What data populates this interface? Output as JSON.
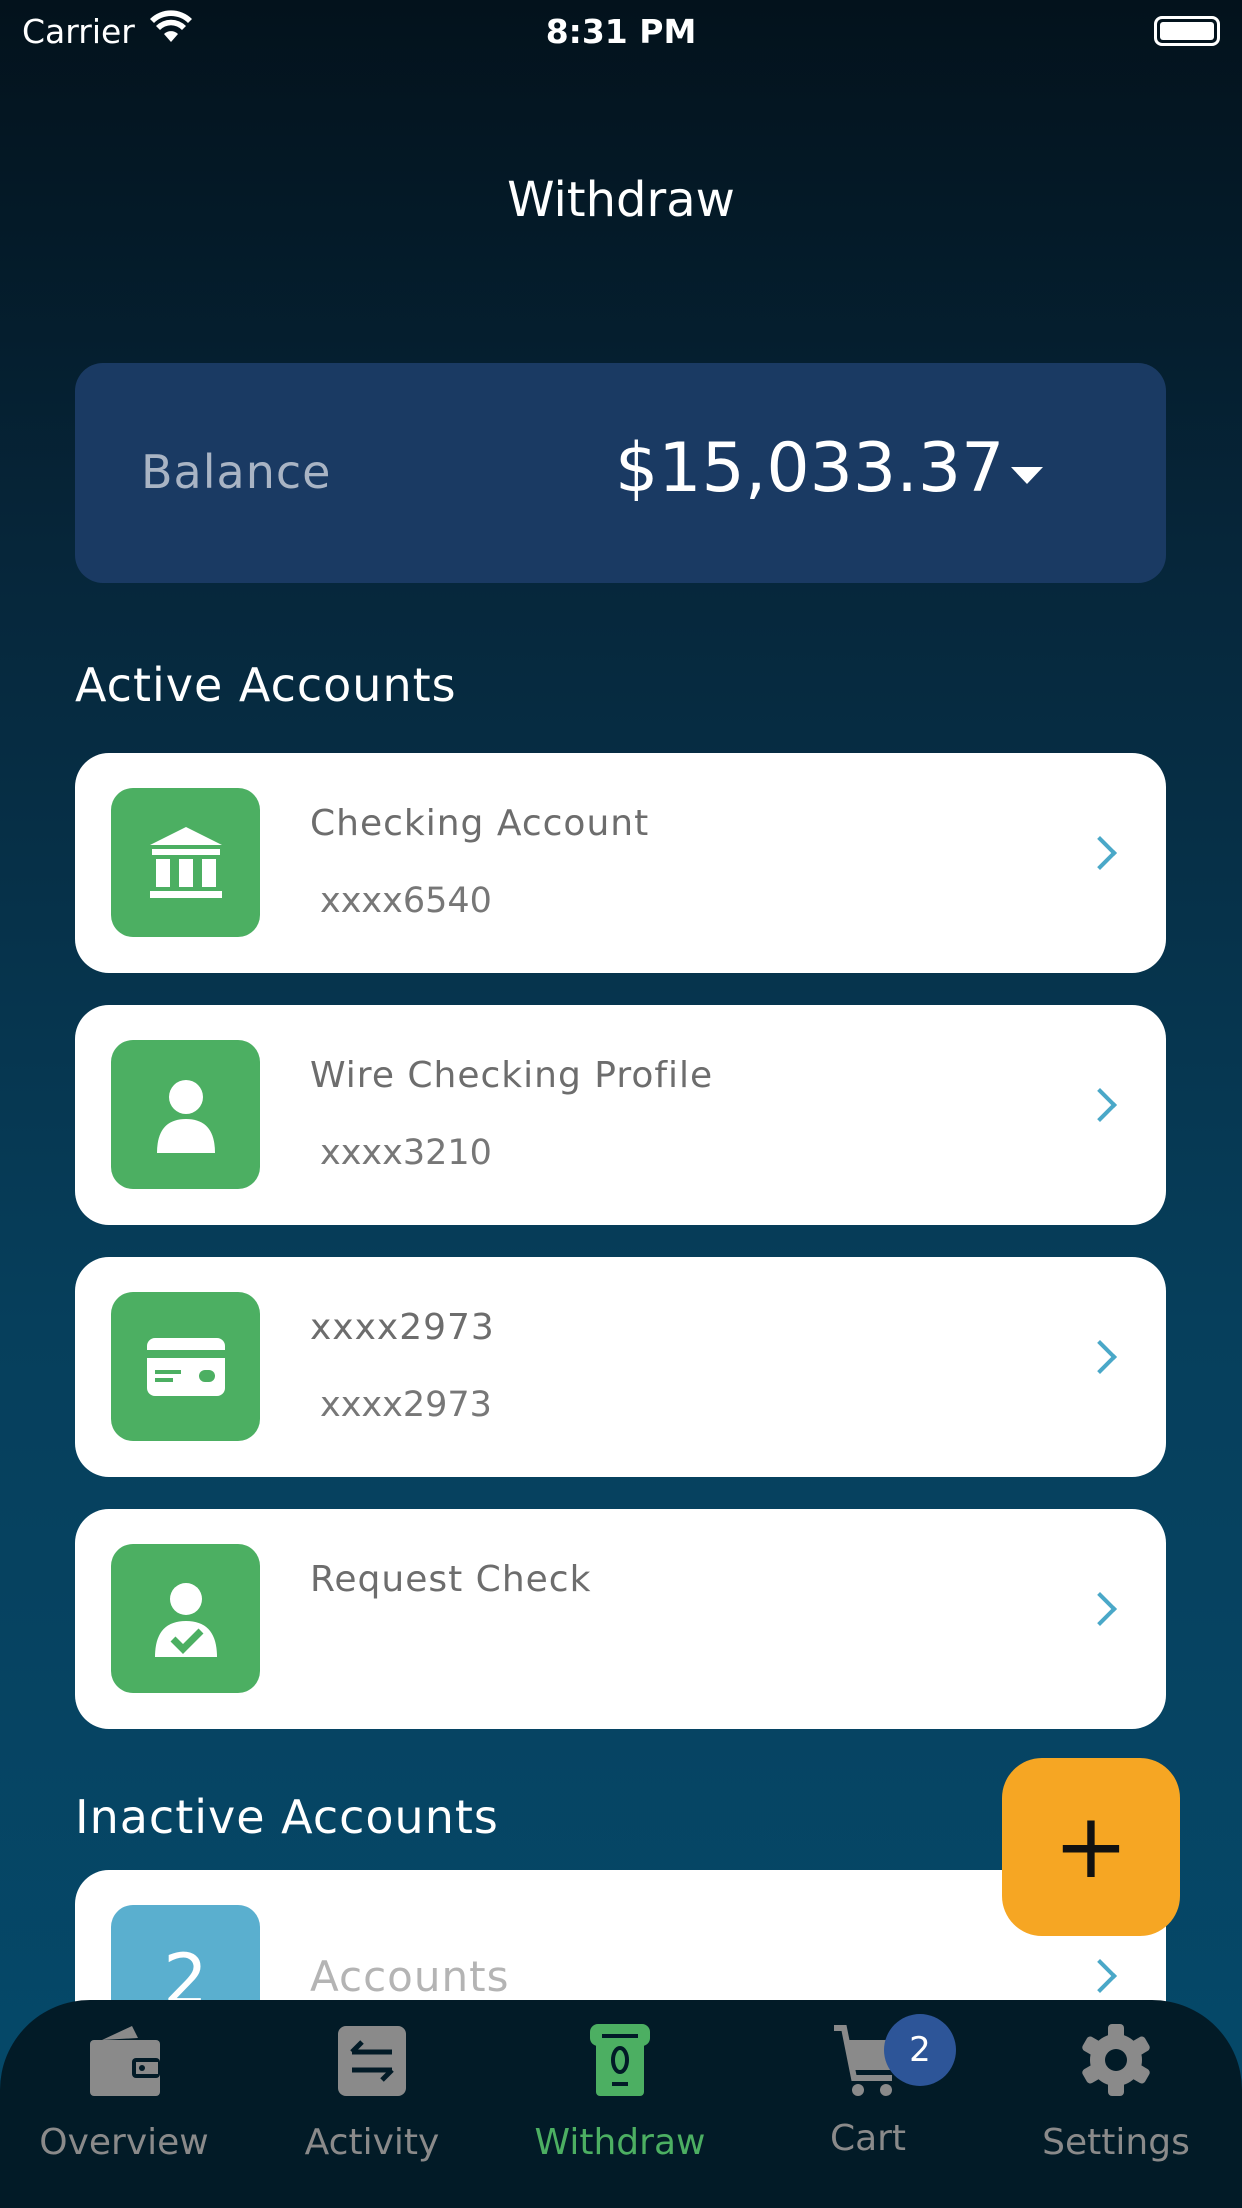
{
  "status_bar": {
    "carrier": "Carrier",
    "time": "8:31 PM"
  },
  "header": {
    "title": "Withdraw"
  },
  "balance": {
    "label": "Balance",
    "amount": "$15,033.37"
  },
  "active_section": {
    "title": "Active Accounts",
    "items": [
      {
        "title": "Checking Account",
        "subtitle": "xxxx6540",
        "icon": "bank-icon"
      },
      {
        "title": "Wire Checking Profile",
        "subtitle": "xxxx3210",
        "icon": "user-icon"
      },
      {
        "title": "xxxx2973",
        "subtitle": "xxxx2973",
        "icon": "card-icon"
      },
      {
        "title": "Request Check",
        "subtitle": "",
        "icon": "user-check-icon"
      }
    ]
  },
  "inactive_section": {
    "title": "Inactive Accounts",
    "items": [
      {
        "count": "2",
        "title": "Accounts"
      }
    ]
  },
  "fab": {
    "label": "+"
  },
  "nav": {
    "active": "Withdraw",
    "active_color": "#4caf62",
    "items": [
      {
        "label": "Overview"
      },
      {
        "label": "Activity"
      },
      {
        "label": "Withdraw"
      },
      {
        "label": "Cart",
        "badge": "2"
      },
      {
        "label": "Settings"
      }
    ]
  },
  "colors": {
    "accent_green": "#4caf62",
    "fab": "#f6a623",
    "balance_card": "#1a3a63",
    "badge": "#2d5598"
  }
}
